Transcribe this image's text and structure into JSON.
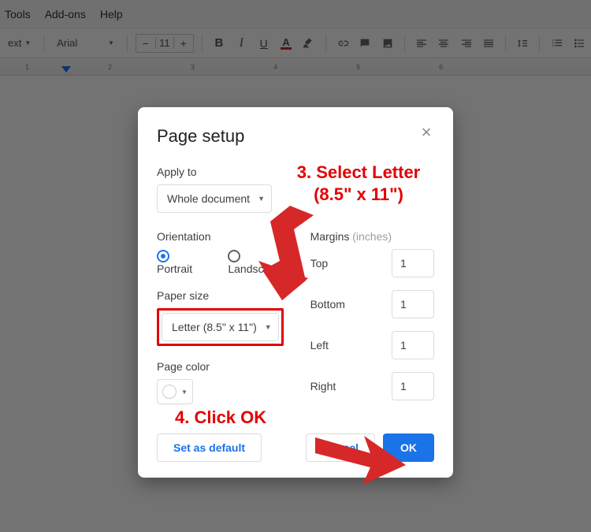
{
  "menubar": {
    "items": [
      "Tools",
      "Add-ons",
      "Help"
    ]
  },
  "toolbar": {
    "style": "ext",
    "font": "Arial",
    "font_size": "11"
  },
  "ruler": {
    "ticks": [
      "1",
      "2",
      "3",
      "4",
      "5",
      "6"
    ]
  },
  "dialog": {
    "title": "Page setup",
    "apply_to_label": "Apply to",
    "apply_to_value": "Whole document",
    "orientation_label": "Orientation",
    "orientation_portrait": "Portrait",
    "orientation_landscape": "Landscape",
    "paper_size_label": "Paper size",
    "paper_size_value": "Letter (8.5\" x 11\")",
    "page_color_label": "Page color",
    "margins_label": "Margins",
    "margins_unit": "(inches)",
    "margins": {
      "top_label": "Top",
      "top_value": "1",
      "bottom_label": "Bottom",
      "bottom_value": "1",
      "left_label": "Left",
      "left_value": "1",
      "right_label": "Right",
      "right_value": "1"
    },
    "set_default": "Set as default",
    "cancel": "Cancel",
    "ok": "OK"
  },
  "annotations": {
    "step3a": "3. Select Letter",
    "step3b": "(8.5\" x 11\")",
    "step4": "4. Click OK"
  }
}
